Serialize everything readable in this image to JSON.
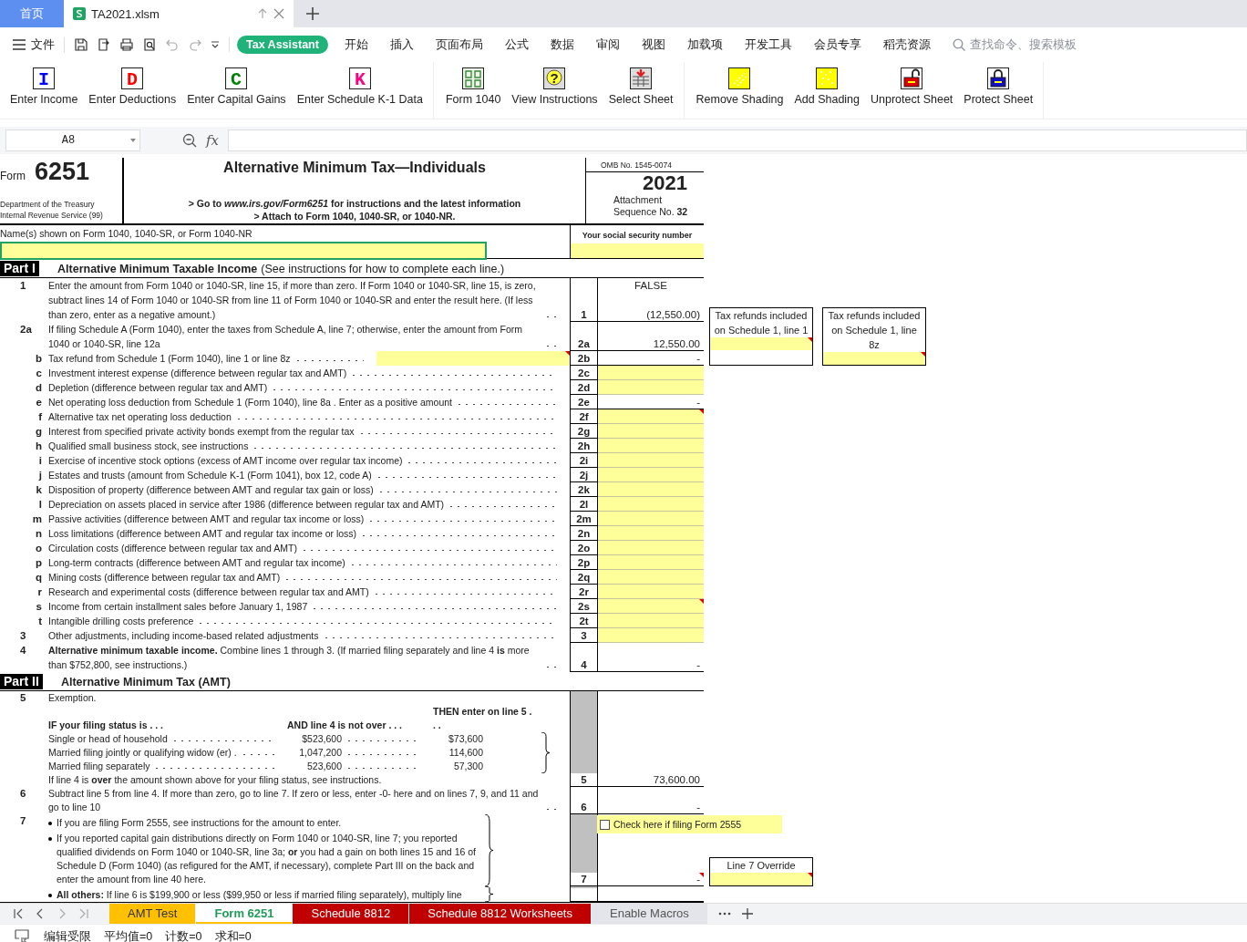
{
  "tabs": [
    {
      "label": "首页",
      "kind": "home",
      "selected": false
    },
    {
      "label": "TA2021.xlsm",
      "kind": "file",
      "selected": true
    }
  ],
  "menu": {
    "file_label": "文件",
    "ribbon_tabs": [
      {
        "label": "Tax Assistant",
        "selected": true
      },
      {
        "label": "开始",
        "selected": false
      },
      {
        "label": "插入",
        "selected": false
      },
      {
        "label": "页面布局",
        "selected": false
      },
      {
        "label": "公式",
        "selected": false
      },
      {
        "label": "数据",
        "selected": false
      },
      {
        "label": "审阅",
        "selected": false
      },
      {
        "label": "视图",
        "selected": false
      },
      {
        "label": "加载项",
        "selected": false
      },
      {
        "label": "开发工具",
        "selected": false
      },
      {
        "label": "会员专享",
        "selected": false
      },
      {
        "label": "稻壳资源",
        "selected": false
      }
    ],
    "search": {
      "placeholder": "查找命令、搜索模板"
    }
  },
  "ribbon_groups": [
    {
      "buttons": [
        {
          "label": "Enter Income",
          "kind": "letter",
          "glyph": "I",
          "color": "#0000ff"
        },
        {
          "label": "Enter Deductions",
          "kind": "letter",
          "glyph": "D",
          "color": "#ff0000"
        },
        {
          "label": "Enter Capital Gains",
          "kind": "letter",
          "glyph": "C",
          "color": "#008000"
        },
        {
          "label": "Enter Schedule K-1 Data",
          "kind": "letter",
          "glyph": "K",
          "color": "#ff0080"
        }
      ]
    },
    {
      "buttons": [
        {
          "label": "Form 1040",
          "kind": "form"
        },
        {
          "label": "View Instructions",
          "kind": "help",
          "glyph": "?"
        },
        {
          "label": "Select Sheet",
          "kind": "sheet"
        }
      ]
    },
    {
      "buttons": [
        {
          "label": "Remove Shading",
          "kind": "shade-off"
        },
        {
          "label": "Add Shading",
          "kind": "shade"
        },
        {
          "label": "Unprotect Sheet",
          "kind": "unlock"
        },
        {
          "label": "Protect Sheet",
          "kind": "lock"
        }
      ]
    }
  ],
  "formula_bar": {
    "cell": "A8",
    "fx": "fx"
  },
  "form": {
    "form_word": "Form",
    "number": "6251",
    "department": "Department of the Treasury",
    "service": "Internal Revenue Service  (99)",
    "title": "Alternative Minimum Tax—Individuals",
    "instructions": [
      "> Go to *www.irs.gov/Form6251* for instructions and the latest information",
      "> Attach to Form 1040, 1040-SR, or 1040-NR."
    ],
    "omb": "OMB No. 1545-0074",
    "year": "2021",
    "attachment": "Attachment",
    "sequence": "Sequence No. **32**",
    "name_label": "Name(s) shown on Form 1040, 1040-SR, or Form 1040-NR",
    "name_selected": true,
    "ssn_label": "Your social security number"
  },
  "parts": [
    {
      "label": "Part I",
      "title": "Alternative Minimum Taxable Income",
      "note": "(See instructions for how to complete each line.)",
      "lines": [
        {
          "num": "1",
          "text": "Enter the amount from Form 1040 or 1040-SR, line 15, if more than zero. If Form 1040 or 1040-SR, line 15, is zero, subtract lines 14 of Form 1040 or 1040-SR from line 11 of Form 1040 or 1040-SR and enter the result here. (If less than zero, enter as a negative amount.)",
          "leader": true,
          "label": "1",
          "value": "(12,550.00)",
          "flag": "FALSE",
          "input": false
        },
        {
          "num": "2a",
          "text": "If filing Schedule A (Form 1040), enter the taxes from Schedule A, line 7; otherwise, enter the amount from Form 1040 or 1040-SR, line 12a",
          "leader": true,
          "label": "2a",
          "value": "12,550.00",
          "input": false
        },
        {
          "letter": "b",
          "text": "Tax refund from Schedule 1 (Form 1040), line 1 or line 8z",
          "leader": true,
          "text_field": true,
          "label": "2b",
          "value": "-",
          "input": false,
          "side_notes": [
            {
              "title": "Tax refunds included on Schedule 1, line 1",
              "note": true
            },
            {
              "title": "Tax refunds included on Schedule 1, line 8z",
              "note": true
            }
          ]
        },
        {
          "letter": "c",
          "text": "Investment interest expense (difference between regular tax and AMT)",
          "leader": true,
          "label": "2c",
          "input": true
        },
        {
          "letter": "d",
          "text": "Depletion (difference between regular tax and AMT)",
          "leader": true,
          "label": "2d",
          "input": true
        },
        {
          "letter": "e",
          "text": "Net operating loss deduction from Schedule 1 (Form 1040), line 8a . Enter as a positive amount",
          "leader": true,
          "label": "2e",
          "value": "-",
          "input": false
        },
        {
          "letter": "f",
          "text": "Alternative tax net operating loss deduction",
          "leader": true,
          "label": "2f",
          "input": true,
          "note": true
        },
        {
          "letter": "g",
          "text": "Interest from specified private activity bonds exempt from the regular tax",
          "leader": true,
          "label": "2g",
          "input": true
        },
        {
          "letter": "h",
          "text": "Qualified small business stock, see instructions",
          "leader": true,
          "label": "2h",
          "input": true
        },
        {
          "letter": "i",
          "text": "Exercise of incentive stock options (excess of AMT income over regular tax income)",
          "leader": true,
          "label": "2i",
          "input": true
        },
        {
          "letter": "j",
          "text": "Estates and trusts (amount from Schedule K-1 (Form 1041), box 12, code A)",
          "leader": true,
          "label": "2j",
          "input": true
        },
        {
          "letter": "k",
          "text": "Disposition of property (difference between AMT and regular tax gain or loss)",
          "leader": true,
          "label": "2k",
          "input": true
        },
        {
          "letter": "l",
          "text": "Depreciation on assets placed in service after 1986 (difference between regular tax and AMT)",
          "leader": true,
          "label": "2l",
          "input": true
        },
        {
          "letter": "m",
          "text": "Passive activities (difference between AMT and regular tax income or loss)",
          "leader": true,
          "label": "2m",
          "input": true
        },
        {
          "letter": "n",
          "text": "Loss limitations (difference between AMT and regular tax income or loss)",
          "leader": true,
          "label": "2n",
          "input": true
        },
        {
          "letter": "o",
          "text": "Circulation costs (difference between regular tax and AMT)",
          "leader": true,
          "label": "2o",
          "input": true
        },
        {
          "letter": "p",
          "text": "Long-term contracts (difference between AMT and regular tax income)",
          "leader": true,
          "label": "2p",
          "input": true
        },
        {
          "letter": "q",
          "text": "Mining costs (difference between regular tax and AMT)",
          "leader": true,
          "label": "2q",
          "input": true
        },
        {
          "letter": "r",
          "text": "Research and experimental costs (difference between regular tax and AMT)",
          "leader": true,
          "label": "2r",
          "input": true
        },
        {
          "letter": "s",
          "text": "Income from certain installment sales before January 1, 1987",
          "leader": true,
          "label": "2s",
          "input": true,
          "note": true
        },
        {
          "letter": "t",
          "text": "Intangible drilling costs preference",
          "leader": true,
          "label": "2t",
          "input": true
        },
        {
          "num": "3",
          "text": "Other adjustments, including income-based related adjustments",
          "leader": true,
          "label": "3",
          "input": true
        },
        {
          "num": "4",
          "text": "**Alternative minimum taxable income.** Combine lines 1 through 3. (If married filing separately and line 4 **is** more than $752,800, see instructions.)",
          "leader": true,
          "label": "4",
          "value": "-",
          "input": false
        }
      ]
    },
    {
      "label": "Part II",
      "title": "Alternative Minimum Tax  (AMT)",
      "lines": [
        {
          "num": "5",
          "shaded": true,
          "label": "5",
          "value": "73,600.00",
          "input": false,
          "brace": true,
          "items": [
            {
              "kind": "text",
              "text": "Exemption."
            },
            {
              "kind": "heading",
              "cells": [
                "IF your filing status is . . .",
                "AND line 4 is not over . . .",
                "THEN enter on line 5 . . ."
              ]
            },
            {
              "kind": "row",
              "cells": [
                "Single or head of household",
                "$523,600",
                "$73,600"
              ]
            },
            {
              "kind": "row",
              "cells": [
                "Married filing jointly or qualifying widow (er) .",
                "1,047,200",
                "114,600"
              ]
            },
            {
              "kind": "row",
              "cells": [
                "Married filing separately",
                "523,600",
                "57,300"
              ]
            },
            {
              "kind": "text",
              "text": "If line 4 is **over** the amount shown above for your filing status, see instructions."
            }
          ]
        },
        {
          "num": "6",
          "text": "Subtract line 5 from line 4. If more than zero, go to line 7. If zero or less, enter -0- here and on lines 7, 9, and 11 and go to line 10",
          "leader": true,
          "label": "6",
          "value": "-",
          "input": false
        },
        {
          "num": "7",
          "shaded": true,
          "label": "7",
          "value": "-",
          "input": false,
          "note": true,
          "brace": true,
          "checkbox": {
            "label": "Check here if filing Form 2555",
            "checked": false
          },
          "side_notes": [
            {
              "title": "Line 7 Override",
              "note": true
            }
          ],
          "items": [
            {
              "kind": "bullet",
              "text": "If you are filing Form 2555, see instructions for the amount to enter."
            },
            {
              "kind": "bullet",
              "text": "If you reported capital gain distributions directly on Form 1040 or 1040-SR, line 7; you reported qualified dividends on Form 1040 or 1040-SR, line 3a; **or** you had a gain on both lines 15 and 16 of Schedule D (Form 1040) (as refigured for the AMT, if necessary), complete Part III on the back and enter the amount from line 40 here."
            }
          ]
        },
        {
          "shaded": true,
          "brace": true,
          "items": [
            {
              "kind": "bullet",
              "text": "**All others:** If line 6 is $199,900 or less ($99,950 or less if married filing separately), multiply line"
            }
          ]
        }
      ]
    }
  ],
  "sheet_tabs": [
    {
      "label": "AMT Test",
      "color": "#ffc000",
      "selected": false
    },
    {
      "label": "Form 6251",
      "color": "#ffffff",
      "selected": true
    },
    {
      "label": "Schedule 8812",
      "color": "#c00000",
      "selected": false
    },
    {
      "label": "Schedule 8812 Worksheets",
      "color": "#c00000",
      "selected": false
    },
    {
      "label": "Enable Macros",
      "color": "#e3e5ea",
      "selected": false
    }
  ],
  "status_bar": [
    "编辑受限",
    "平均值=0",
    "计数=0",
    "求和=0"
  ]
}
